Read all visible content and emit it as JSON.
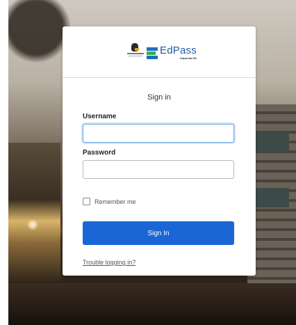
{
  "brand": {
    "school_name": "KAPUNDA",
    "school_tagline": "HIGH SCHOOL",
    "product_name_prefix": "Ed",
    "product_name_suffix": "Pass",
    "product_sub": "Kapunda HS"
  },
  "form": {
    "title": "Sign in",
    "username_label": "Username",
    "username_value": "",
    "password_label": "Password",
    "password_value": "",
    "remember_label": "Remember me",
    "remember_checked": false,
    "signin_label": "Sign In",
    "trouble_link": "Trouble logging in?"
  },
  "colors": {
    "primary_button": "#1a66d6",
    "focus_ring": "#6aa5e8"
  },
  "icons": [
    "school-crest-icon",
    "edpass-logo-icon",
    "checkbox-icon"
  ]
}
